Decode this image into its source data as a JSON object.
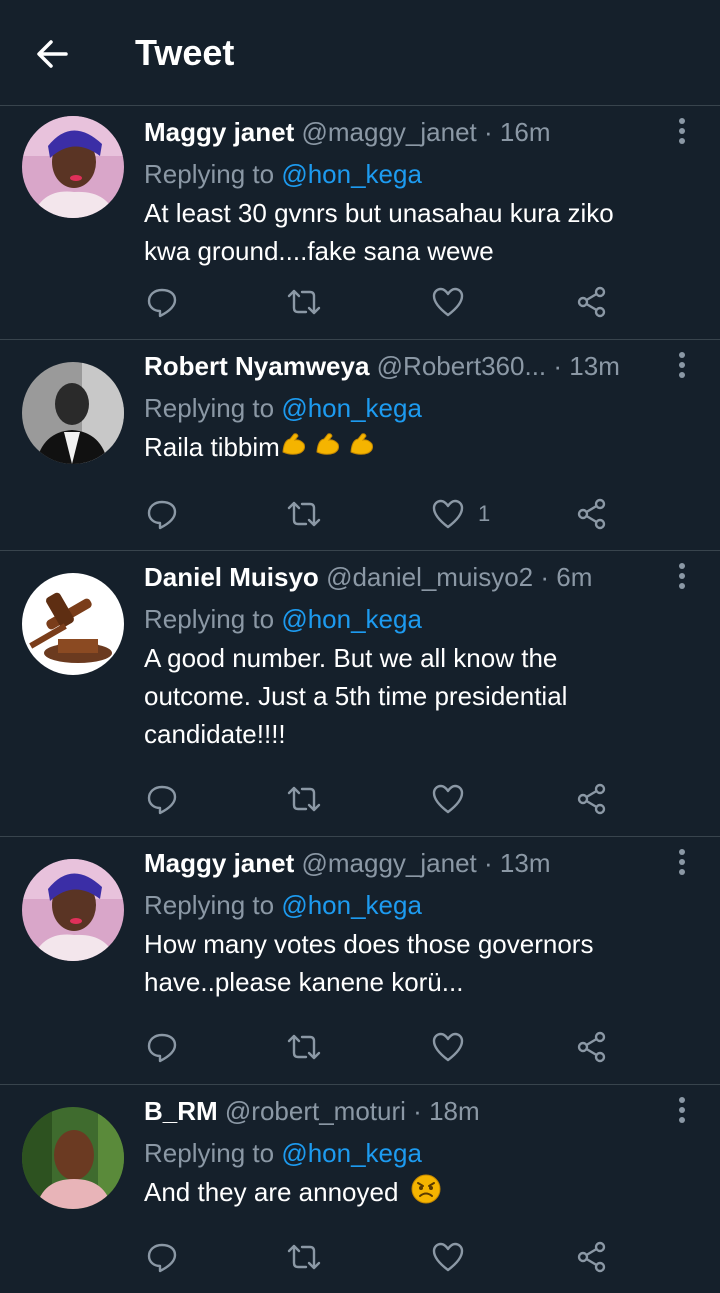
{
  "header": {
    "title": "Tweet"
  },
  "replies": [
    {
      "name": "Maggy janet",
      "handle": "@maggy_janet",
      "separator": "·",
      "time": "16m",
      "replying_prefix": "Replying to",
      "replying_to": "@hon_kega",
      "text_lines": [
        "At least 30 gvnrs but unasahau kura ziko",
        "kwa ground....fake sana wewe"
      ],
      "like_count": ""
    },
    {
      "name": "Robert Nyamweya",
      "handle": "@Robert360...",
      "separator": "·",
      "time": "13m",
      "replying_prefix": "Replying to",
      "replying_to": "@hon_kega",
      "text_lines": [
        "Raila tibbim"
      ],
      "emojis": [
        "flexed-biceps",
        "flexed-biceps",
        "flexed-biceps"
      ],
      "like_count": "1"
    },
    {
      "name": "Daniel Muisyo",
      "handle": "@daniel_muisyo2",
      "separator": "·",
      "time": "6m",
      "replying_prefix": "Replying to",
      "replying_to": "@hon_kega",
      "text_lines": [
        "A good number. But we all know the",
        "outcome. Just a 5th time presidential",
        "candidate!!!!"
      ],
      "like_count": ""
    },
    {
      "name": "Maggy janet",
      "handle": "@maggy_janet",
      "separator": "·",
      "time": "13m",
      "replying_prefix": "Replying to",
      "replying_to": "@hon_kega",
      "text_lines": [
        "How many votes does those governors",
        "have..please kanene korü..."
      ],
      "like_count": ""
    },
    {
      "name": "B_RM",
      "handle": "@robert_moturi",
      "separator": "·",
      "time": "18m",
      "replying_prefix": "Replying to",
      "replying_to": "@hon_kega",
      "text_lines": [
        "And they are annoyed"
      ],
      "emojis": [
        "angry-face"
      ],
      "like_count": ""
    }
  ],
  "colors": {
    "background": "#15202b",
    "divider": "#38444d",
    "secondary_text": "#8b98a5",
    "mention": "#1d9bf0"
  }
}
